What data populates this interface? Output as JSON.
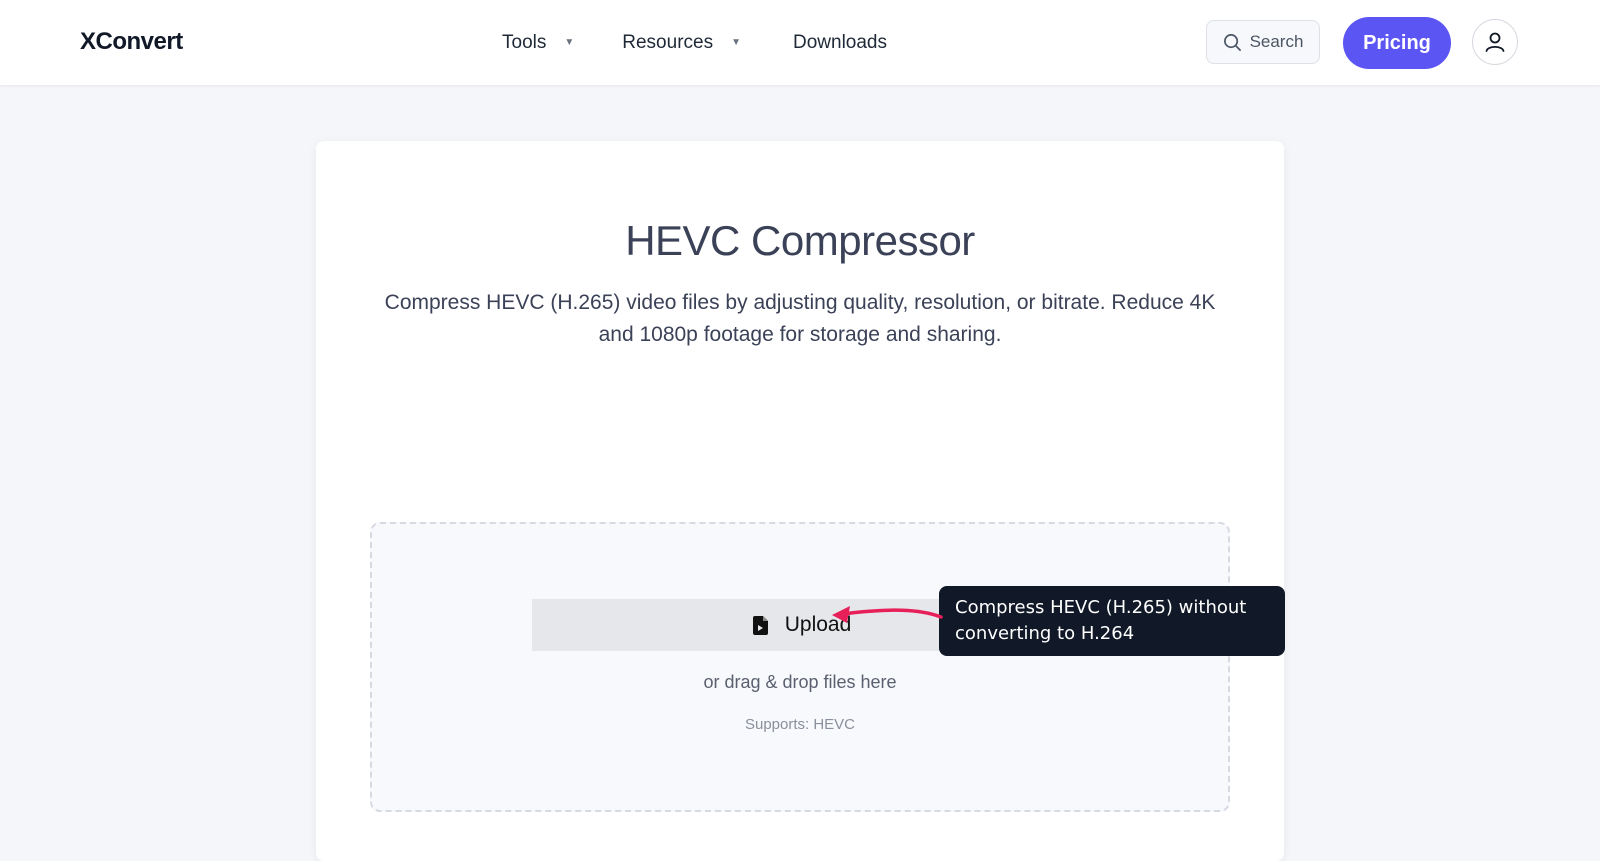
{
  "header": {
    "logo": "XConvert",
    "nav": [
      {
        "label": "Tools",
        "has_dropdown": true
      },
      {
        "label": "Resources",
        "has_dropdown": true
      },
      {
        "label": "Downloads",
        "has_dropdown": false
      }
    ],
    "search_label": "Search",
    "pricing_label": "Pricing",
    "caret_glyph": "▼"
  },
  "main": {
    "title": "HEVC Compressor",
    "subtitle": "Compress HEVC (H.265) video files by adjusting quality, resolution, or bitrate. Reduce 4K and 1080p footage for storage and sharing.",
    "upload": {
      "button_label": "Upload",
      "drag_text": "or drag & drop files here",
      "supports_text": "Supports: HEVC"
    }
  },
  "tooltip": {
    "text": "Compress HEVC (H.265) without converting to H.264"
  },
  "colors": {
    "accent": "#5b55f3",
    "tooltip_bg": "#111827",
    "arrow": "#e8205a"
  },
  "icons": [
    "search-icon",
    "user-icon",
    "file-icon",
    "caret-down-icon",
    "arrow-annotation"
  ]
}
